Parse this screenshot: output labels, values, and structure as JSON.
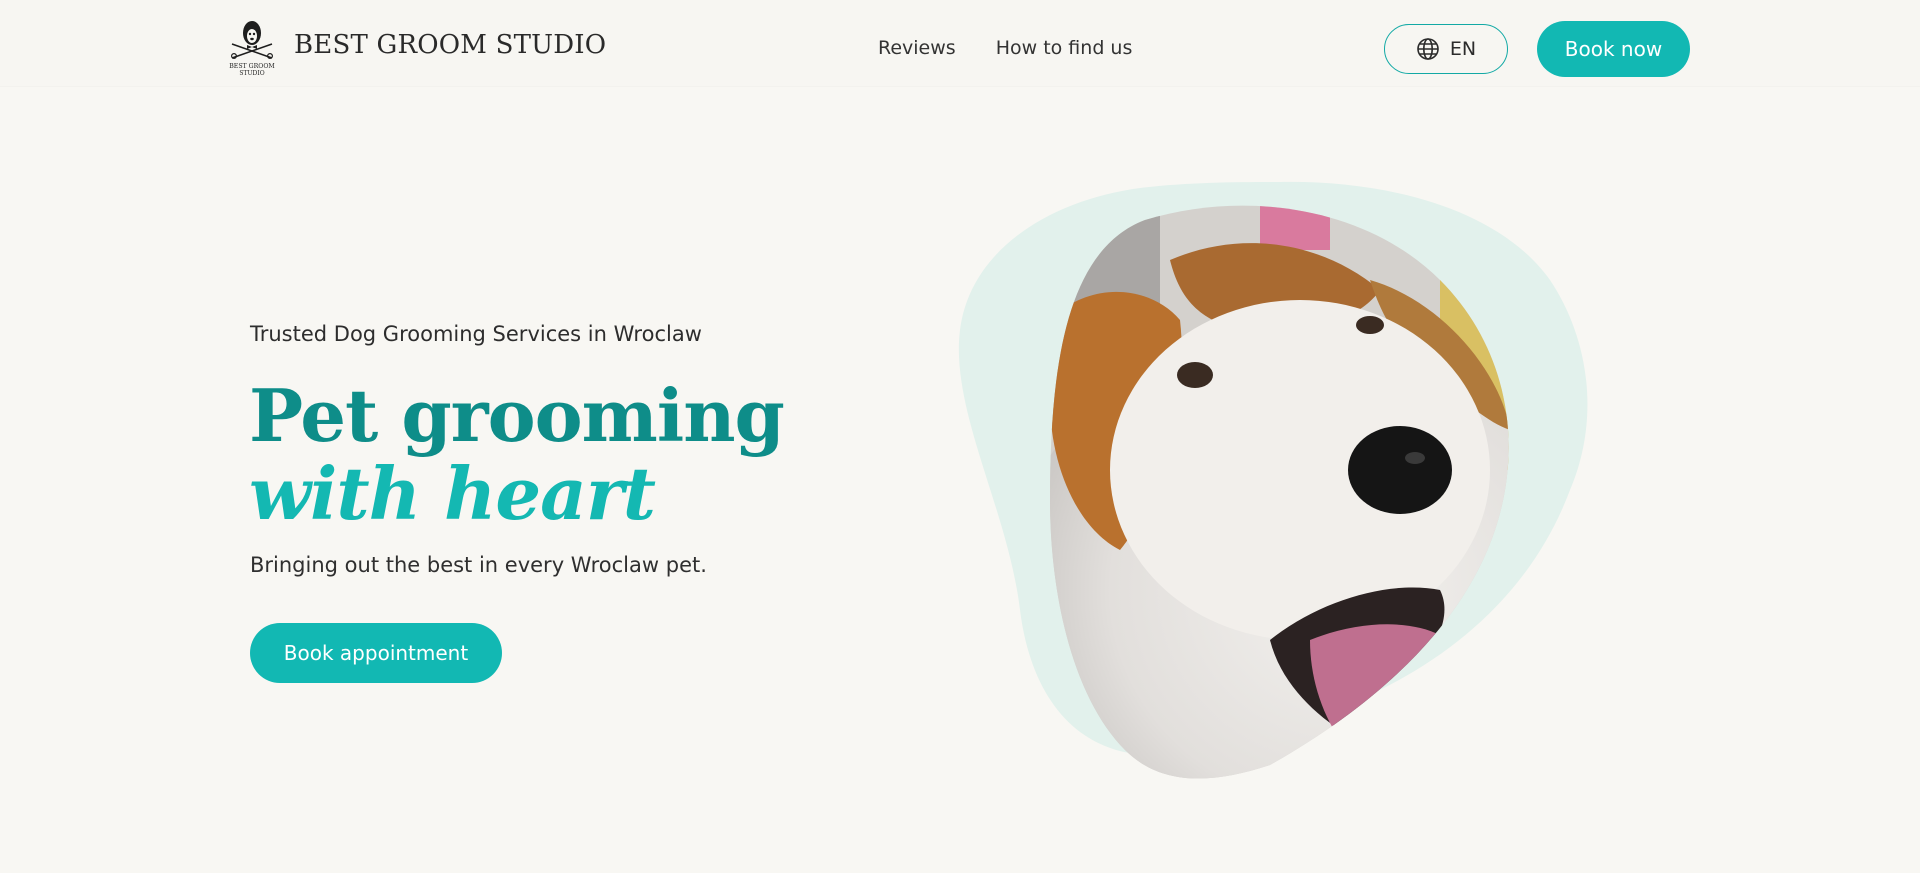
{
  "header": {
    "brand": "BEST GROOM STUDIO",
    "logo_text_line1": "BEST GROOM",
    "logo_text_line2": "STUDIO",
    "nav": [
      {
        "label": "Reviews"
      },
      {
        "label": "How to find us"
      }
    ],
    "language": "EN",
    "book_now": "Book now"
  },
  "hero": {
    "eyebrow": "Trusted Dog Grooming Services in Wroclaw",
    "headline_plain": "Pet grooming ",
    "headline_accent": "with heart",
    "subtext": "Bringing out the best in every Wroclaw pet.",
    "cta": "Book appointment"
  },
  "colors": {
    "background": "#f8f7f3",
    "accent": "#12b8b3",
    "headline": "#0e8d89",
    "blob": "#e2f1ec"
  },
  "icons": {
    "language": "globe-icon",
    "logo": "dog-scissors-logo-icon"
  }
}
